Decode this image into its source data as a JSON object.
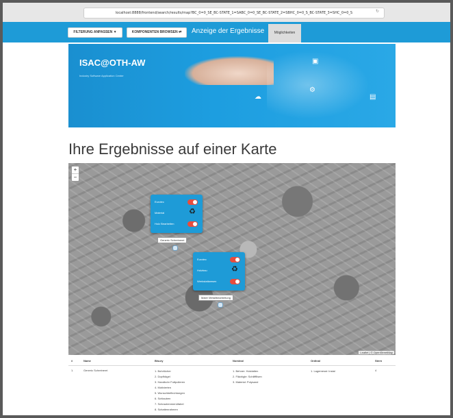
{
  "browser": {
    "url": "localhost:8888/frontend/search/results/map?BC_0=0_SE_BC-STATE_1=SABC_0=0_SE_BC-STATE_2=SBHC_0=0_S_BC-STATE_3=SHC_0=0_S"
  },
  "nav": {
    "filter_button": "FILTERUNG ANPASSEN",
    "components_button": "KOMPONENTEN BROWSEN",
    "title": "Anzeige der Ergebnisse",
    "tab_label": "Möglichkeiten"
  },
  "banner": {
    "title": "ISAC@OTH-AW",
    "subtitle": "Industry Software Application Center"
  },
  "heading": "Ihre Ergebnisse auf einer Karte",
  "map": {
    "zoom_in": "+",
    "zoom_out": "−",
    "attribution": "Leaflet | © OpenStreetMap",
    "popups": [
      {
        "rows": [
          "Eurotec",
          "Material",
          "Holz Bearbeiten"
        ],
        "label": "Generic Schreinerei"
      },
      {
        "rows": [
          "Eurotec",
          "Holzbau",
          "Werkstattwesen"
        ],
        "label": "Maier Metallbearbeitung"
      }
    ]
  },
  "table": {
    "headers": [
      "#",
      "Name",
      "Bisury",
      "Nominal",
      "Ordinal",
      "Stern"
    ],
    "row": {
      "index": "1.",
      "name": "Generic Schreinerei",
      "bisury": [
        "1. Bohrlöcher",
        "2. Dopfhägel",
        "3. Handbohr Futtpolieren",
        "4. Motivierten",
        "5. Wunschbeflechtungen",
        "6. Schlauben",
        "7. Schraubenmenüfabel",
        "8. Schattenrahmen"
      ],
      "nominal": [
        "1. Behner: Holzlatten",
        "2. Flächigle: Schliffflisen",
        "3. Material: Polysand"
      ],
      "ordinal": [
        "1. Lagemesst: Instal"
      ],
      "stern": "4"
    }
  },
  "colors": {
    "accent": "#1e9bd7",
    "toggle": "#e84c3d"
  }
}
